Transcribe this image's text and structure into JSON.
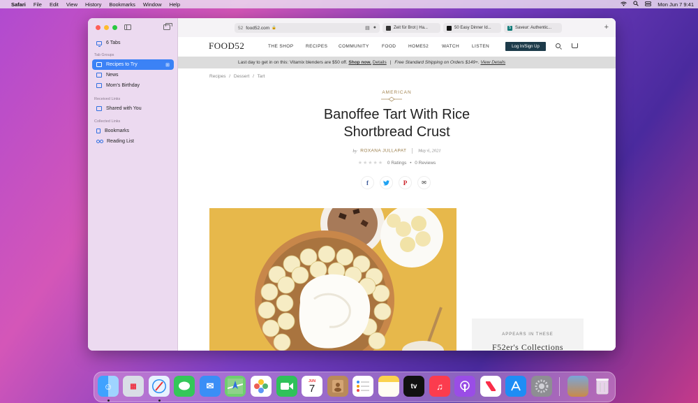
{
  "menubar": {
    "app": "Safari",
    "items": [
      "File",
      "Edit",
      "View",
      "History",
      "Bookmarks",
      "Window",
      "Help"
    ],
    "datetime": "Mon Jun 7  9:41"
  },
  "sidebar": {
    "tabs_count": "6 Tabs",
    "groups_header": "Tab Groups",
    "groups": [
      "Recipes to Try",
      "News",
      "Mom's Birthday"
    ],
    "received_header": "Received Links",
    "received": [
      "Shared with You"
    ],
    "collected_header": "Collected Links",
    "collected": [
      "Bookmarks",
      "Reading List"
    ]
  },
  "tabbar": {
    "url_prefix": "52",
    "url": "food52.com",
    "tabs": [
      "Zeit für Brot | Ha...",
      "50 Easy Dinner Id...",
      "Saveur: Authentic..."
    ],
    "tab_icon_letters": [
      "",
      "",
      "S"
    ]
  },
  "site": {
    "logo": "FOOD52",
    "nav": [
      "THE SHOP",
      "RECIPES",
      "COMMUNITY",
      "FOOD",
      "HOME52",
      "WATCH",
      "LISTEN"
    ],
    "login": "Log In/Sign Up",
    "banner": {
      "text": "Last day to get in on this: Vitamix blenders are $50 off.",
      "shop_now": "Shop now.",
      "details1": "Details",
      "divider": "|",
      "shipping": "Free Standard Shipping on Orders $149+.",
      "details2": "View Details"
    },
    "breadcrumb": [
      "Recipes",
      "/",
      "Dessert",
      "/",
      "Tart"
    ],
    "eyebrow": "AMERICAN",
    "title_line1": "Banoffee Tart With Rice",
    "title_line2": "Shortbread Crust",
    "by": "by",
    "author": "ROXANA JULLAPAT",
    "date": "May 6, 2021",
    "stars": "★★★★★",
    "ratings": "0 Ratings",
    "dot": "•",
    "reviews": "0 Reviews",
    "share": {
      "facebook": "f",
      "twitter": "🐦",
      "pinterest": "P",
      "email": "✉"
    },
    "collections_label": "APPEARS IN THESE",
    "collections_title": "F52er's Collections"
  },
  "dock": {
    "calendar_month": "JUN",
    "calendar_day": "7",
    "apps": [
      "finder",
      "launchpad",
      "safari",
      "messages",
      "mail",
      "maps",
      "photos",
      "facetime",
      "calendar",
      "contacts",
      "reminders",
      "notes",
      "tv",
      "music",
      "podcasts",
      "news",
      "app-store",
      "system-preferences",
      "photo",
      "trash"
    ]
  },
  "colors": {
    "accent": "#3b82f6",
    "login_bg": "#1d3b4a",
    "gold": "#a0824d"
  }
}
